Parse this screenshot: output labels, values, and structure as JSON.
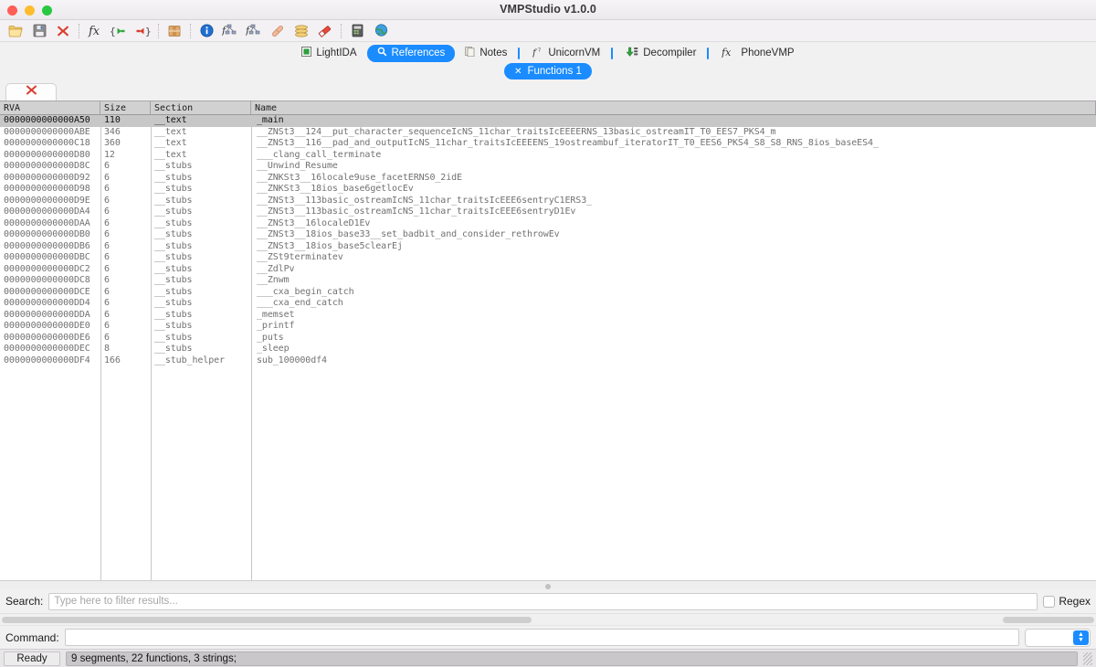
{
  "window": {
    "title": "VMPStudio v1.0.0",
    "controls": [
      "close",
      "minimize",
      "zoom"
    ]
  },
  "toolbar": {
    "groups": [
      [
        {
          "name": "open-file-icon",
          "label": "Open"
        },
        {
          "name": "save-file-icon",
          "label": "Save"
        },
        {
          "name": "close-file-icon",
          "label": "Close"
        }
      ],
      [
        {
          "name": "function-icon",
          "label": "Functions"
        },
        {
          "name": "jump-back-icon",
          "label": "Jump Back"
        },
        {
          "name": "jump-forward-icon",
          "label": "Jump Forward"
        }
      ],
      [
        {
          "name": "package-icon",
          "label": "Package"
        }
      ],
      [
        {
          "name": "info-icon",
          "label": "Info"
        },
        {
          "name": "graph-icon",
          "label": "Graph"
        },
        {
          "name": "graph-alt-icon",
          "label": "Call Graph"
        },
        {
          "name": "patch-icon",
          "label": "Patch"
        },
        {
          "name": "stack-icon",
          "label": "Segments"
        },
        {
          "name": "eraser-icon",
          "label": "Erase"
        }
      ],
      [
        {
          "name": "server-icon",
          "label": "Server"
        },
        {
          "name": "globe-icon",
          "label": "Network"
        }
      ]
    ]
  },
  "tabs": {
    "items": [
      {
        "label": "LightIDA",
        "icon": "chip-icon",
        "active": false,
        "divider": false
      },
      {
        "label": "References",
        "icon": "magnifier-icon",
        "active": true,
        "divider": false
      },
      {
        "label": "Notes",
        "icon": "notes-icon",
        "active": false,
        "divider": false
      },
      {
        "label": "UnicornVM",
        "icon": "unicorn-icon",
        "active": false,
        "divider": true
      },
      {
        "label": "Decompiler",
        "icon": "download-icon",
        "active": false,
        "divider": true
      },
      {
        "label": "PhoneVMP",
        "icon": "fx-icon",
        "active": false,
        "divider": true
      }
    ],
    "subtab": {
      "label": "Functions 1",
      "close_glyph": "✕"
    }
  },
  "panel": {
    "close_tab_icon": "red-x-icon"
  },
  "table": {
    "columns": [
      "RVA",
      "Size",
      "Section",
      "Name"
    ],
    "rows": [
      {
        "rva": "0000000000000A50",
        "size": "110",
        "section": "__text",
        "name": "_main",
        "selected": true
      },
      {
        "rva": "0000000000000ABE",
        "size": "346",
        "section": "__text",
        "name": "__ZNSt3__124__put_character_sequenceIcNS_11char_traitsIcEEEERNS_13basic_ostreamIT_T0_EES7_PKS4_m",
        "selected": false
      },
      {
        "rva": "0000000000000C18",
        "size": "360",
        "section": "__text",
        "name": "__ZNSt3__116__pad_and_outputIcNS_11char_traitsIcEEEENS_19ostreambuf_iteratorIT_T0_EES6_PKS4_S8_S8_RNS_8ios_baseES4_",
        "selected": false
      },
      {
        "rva": "0000000000000D80",
        "size": "12",
        "section": "__text",
        "name": "___clang_call_terminate",
        "selected": false
      },
      {
        "rva": "0000000000000D8C",
        "size": "6",
        "section": "__stubs",
        "name": "__Unwind_Resume",
        "selected": false
      },
      {
        "rva": "0000000000000D92",
        "size": "6",
        "section": "__stubs",
        "name": "__ZNKSt3__16locale9use_facetERNS0_2idE",
        "selected": false
      },
      {
        "rva": "0000000000000D98",
        "size": "6",
        "section": "__stubs",
        "name": "__ZNKSt3__18ios_base6getlocEv",
        "selected": false
      },
      {
        "rva": "0000000000000D9E",
        "size": "6",
        "section": "__stubs",
        "name": "__ZNSt3__113basic_ostreamIcNS_11char_traitsIcEEE6sentryC1ERS3_",
        "selected": false
      },
      {
        "rva": "0000000000000DA4",
        "size": "6",
        "section": "__stubs",
        "name": "__ZNSt3__113basic_ostreamIcNS_11char_traitsIcEEE6sentryD1Ev",
        "selected": false
      },
      {
        "rva": "0000000000000DAA",
        "size": "6",
        "section": "__stubs",
        "name": "__ZNSt3__16localeD1Ev",
        "selected": false
      },
      {
        "rva": "0000000000000DB0",
        "size": "6",
        "section": "__stubs",
        "name": "__ZNSt3__18ios_base33__set_badbit_and_consider_rethrowEv",
        "selected": false
      },
      {
        "rva": "0000000000000DB6",
        "size": "6",
        "section": "__stubs",
        "name": "__ZNSt3__18ios_base5clearEj",
        "selected": false
      },
      {
        "rva": "0000000000000DBC",
        "size": "6",
        "section": "__stubs",
        "name": "__ZSt9terminatev",
        "selected": false
      },
      {
        "rva": "0000000000000DC2",
        "size": "6",
        "section": "__stubs",
        "name": "__ZdlPv",
        "selected": false
      },
      {
        "rva": "0000000000000DC8",
        "size": "6",
        "section": "__stubs",
        "name": "__Znwm",
        "selected": false
      },
      {
        "rva": "0000000000000DCE",
        "size": "6",
        "section": "__stubs",
        "name": "___cxa_begin_catch",
        "selected": false
      },
      {
        "rva": "0000000000000DD4",
        "size": "6",
        "section": "__stubs",
        "name": "___cxa_end_catch",
        "selected": false
      },
      {
        "rva": "0000000000000DDA",
        "size": "6",
        "section": "__stubs",
        "name": "_memset",
        "selected": false
      },
      {
        "rva": "0000000000000DE0",
        "size": "6",
        "section": "__stubs",
        "name": "_printf",
        "selected": false
      },
      {
        "rva": "0000000000000DE6",
        "size": "6",
        "section": "__stubs",
        "name": "_puts",
        "selected": false
      },
      {
        "rva": "0000000000000DEC",
        "size": "8",
        "section": "__stubs",
        "name": "_sleep",
        "selected": false
      },
      {
        "rva": "0000000000000DF4",
        "size": "166",
        "section": "__stub_helper",
        "name": "sub_100000df4",
        "selected": false
      }
    ]
  },
  "search": {
    "label": "Search:",
    "value": "",
    "placeholder": "Type here to filter results...",
    "regex_label": "Regex",
    "regex_checked": false
  },
  "command": {
    "label": "Command:",
    "value": "",
    "combo_value": ""
  },
  "status": {
    "ready_label": "Ready",
    "message": "9 segments, 22 functions, 3 strings;"
  },
  "colors": {
    "accent": "#1a8cff",
    "selected_row": "#c8c7c8",
    "header_bg": "#d2d1d2",
    "row_text": "#737173",
    "close_red": "#d92d20"
  }
}
